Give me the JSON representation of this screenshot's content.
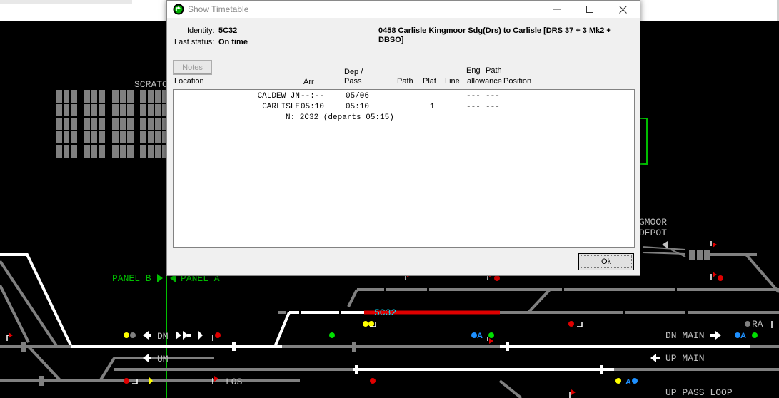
{
  "map": {
    "labels": {
      "scrato": "SCRATO",
      "panel_b": "PANEL B",
      "panel_a": "PANEL A",
      "dm": "DM",
      "um": "UM",
      "los": "LOS",
      "train_id": "5C32",
      "gmoor": "GMOOR",
      "depot": "DEPOT",
      "ra": "RA",
      "dn_main": "DN MAIN",
      "up_main": "UP MAIN",
      "up_pass_loop": "UP PASS LOOP",
      "signal_a": "A"
    },
    "colors": {
      "background": "#000000",
      "track": "#808080",
      "track_set": "#ffffff",
      "track_occupied": "#e00000",
      "panel_text": "#00c000",
      "train_text": "#00e5ff",
      "label_text": "#c0c0c0"
    }
  },
  "dialog": {
    "title": "Show Timetable",
    "identity_label": "Identity:",
    "identity_value": "5C32",
    "last_status_label": "Last status:",
    "last_status_value": "On time",
    "service_line1": "0458 Carlisle Kingmoor Sdg(Drs) to Carlisle [DRS 37 + 3 Mk2 +",
    "service_line2": "DBSO]",
    "notes_button": "Notes",
    "columns": {
      "location": "Location",
      "arr": "Arr",
      "dep_line1": "Dep /",
      "dep_line2": "Pass",
      "path": "Path",
      "plat": "Plat",
      "line": "Line",
      "eng_line1": "Eng",
      "eng_line2": "allowance",
      "pathpos_line1": "Path",
      "pathpos_line2": "Position"
    },
    "rows": [
      {
        "location": "CALDEW JN",
        "arr": "--:--",
        "dep": "05/06",
        "plat": "",
        "eng": "---",
        "pathpos": "---"
      },
      {
        "location": "CARLISLE",
        "arr": "05:10",
        "dep": "05:10",
        "plat": "1",
        "eng": "---",
        "pathpos": "---"
      }
    ],
    "note_line": "N: 2C32 (departs 05:15)",
    "ok_button": "Ok"
  }
}
